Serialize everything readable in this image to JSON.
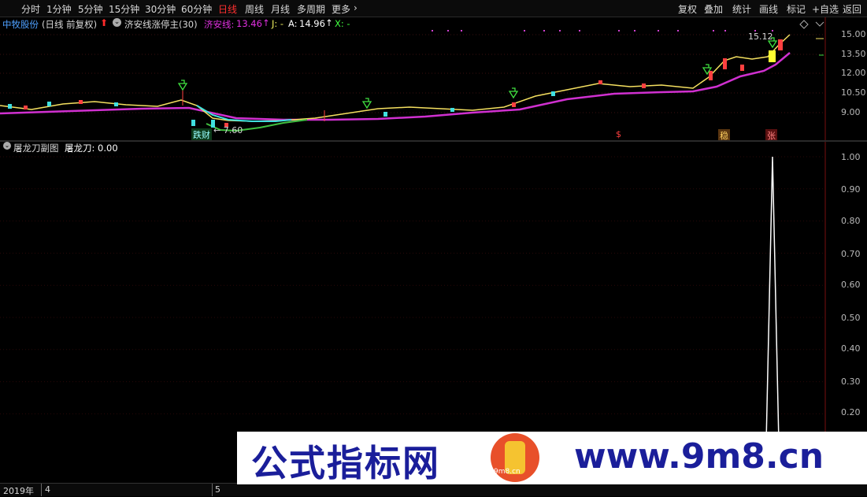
{
  "toolbar": {
    "periods": [
      "分时",
      "1分钟",
      "5分钟",
      "15分钟",
      "30分钟",
      "60分钟",
      "日线",
      "周线",
      "月线",
      "多周期",
      "更多"
    ],
    "active_period": "日线",
    "right": [
      "复权",
      "叠加",
      "统计",
      "画线",
      "标记",
      "+自选",
      "返回"
    ]
  },
  "stock": {
    "name": "中牧股份",
    "mode": "(日线 前复权)",
    "indicator": "济安线涨停主(30)",
    "jian_label": "济安线:",
    "jian_value": "13.46",
    "j_label": "J: -",
    "a_label": "A:",
    "a_value": "14.96",
    "x_label": "X: -",
    "high_price": "15.12",
    "low_price": "7.60"
  },
  "markers": {
    "diecai": "跌财",
    "dollar": "$",
    "wen": "稳",
    "zhang": "张"
  },
  "main_axis": [
    "15.00",
    "13.50",
    "12.00",
    "10.50",
    "9.00"
  ],
  "sub": {
    "title": "屠龙刀副图",
    "value_label": "屠龙刀: 0.00"
  },
  "sub_axis": [
    "1.00",
    "0.90",
    "0.80",
    "0.70",
    "0.60",
    "0.50",
    "0.40",
    "0.30",
    "0.20"
  ],
  "bottom": {
    "year": "2019年",
    "months": [
      "4",
      "5"
    ]
  },
  "watermark": {
    "cn": "公式指标网",
    "en": "www.9m8.cn",
    "logo": "9m8.cn"
  },
  "chart_data": {
    "type": "line",
    "series": [
      {
        "values": [
          0,
          0,
          0,
          0,
          0,
          0,
          0,
          0,
          0,
          0,
          0,
          0,
          0,
          0,
          0,
          0,
          0,
          0,
          0,
          0,
          0,
          0,
          0,
          0,
          0,
          0,
          0,
          0,
          0,
          0,
          0,
          0,
          0,
          0,
          0,
          0,
          0,
          0,
          1,
          0
        ]
      }
    ],
    "ylim": [
      0,
      1.05
    ]
  }
}
